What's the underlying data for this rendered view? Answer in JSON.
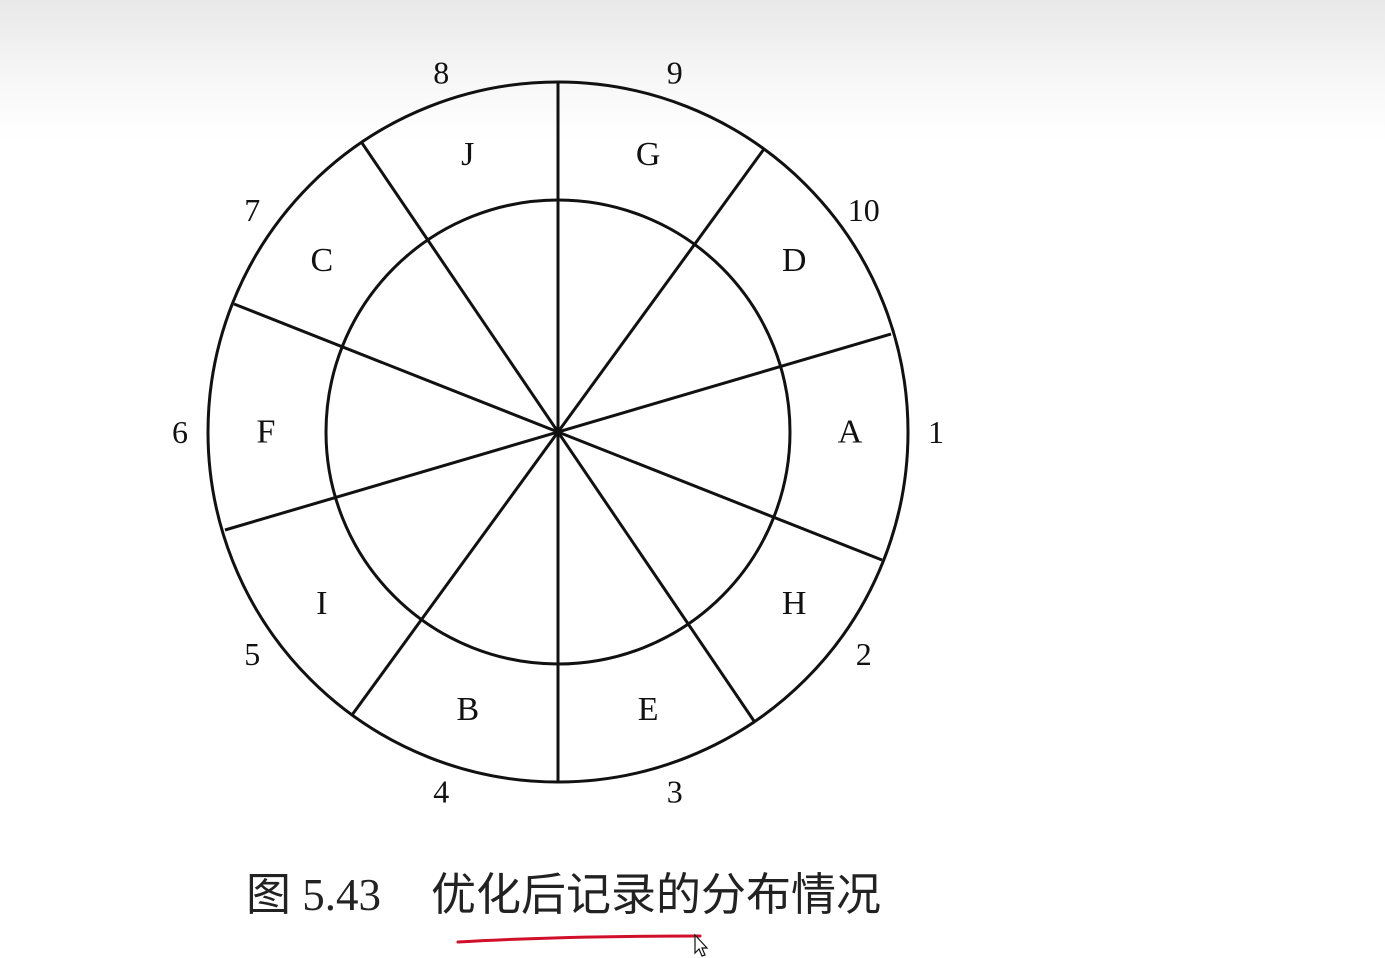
{
  "diagram": {
    "sectors": [
      {
        "letter": "A",
        "number": "1"
      },
      {
        "letter": "H",
        "number": "2"
      },
      {
        "letter": "E",
        "number": "3"
      },
      {
        "letter": "B",
        "number": "4"
      },
      {
        "letter": "I",
        "number": "5"
      },
      {
        "letter": "F",
        "number": "6"
      },
      {
        "letter": "C",
        "number": "7"
      },
      {
        "letter": "J",
        "number": "8"
      },
      {
        "letter": "G",
        "number": "9"
      },
      {
        "letter": "D",
        "number": "10"
      }
    ]
  },
  "caption": {
    "figure_number": "图 5.43",
    "title": "优化后记录的分布情况"
  },
  "colors": {
    "line": "#111111",
    "text": "#222222",
    "underline": "#d0102a"
  }
}
